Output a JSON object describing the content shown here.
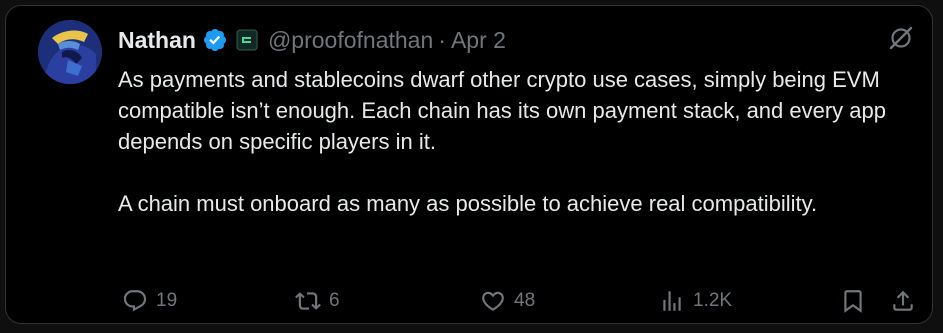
{
  "tweet": {
    "author_name": "Nathan",
    "handle": "@proofofnathan",
    "separator": "·",
    "date": "Apr 2",
    "paragraphs": [
      "As payments and stablecoins dwarf other crypto use cases, simply being EVM compatible isn’t enough. Each chain has its own payment stack, and every app depends on specific players in it.",
      "A chain must onboard as many as possible to achieve real compatibility."
    ]
  },
  "actions": {
    "replies": "19",
    "reposts": "6",
    "likes": "48",
    "views": "1.2K"
  },
  "icons": {
    "verified": "verified-badge-icon",
    "affiliate": "affiliate-badge-icon",
    "grok": "grok-icon",
    "reply": "reply-icon",
    "repost": "repost-icon",
    "like": "heart-icon",
    "views": "views-icon",
    "bookmark": "bookmark-icon",
    "share": "share-icon"
  },
  "colors": {
    "background": "#000000",
    "text": "#e7e9ea",
    "muted": "#71767b",
    "verified": "#1d9bf0",
    "border": "#2f3336"
  }
}
